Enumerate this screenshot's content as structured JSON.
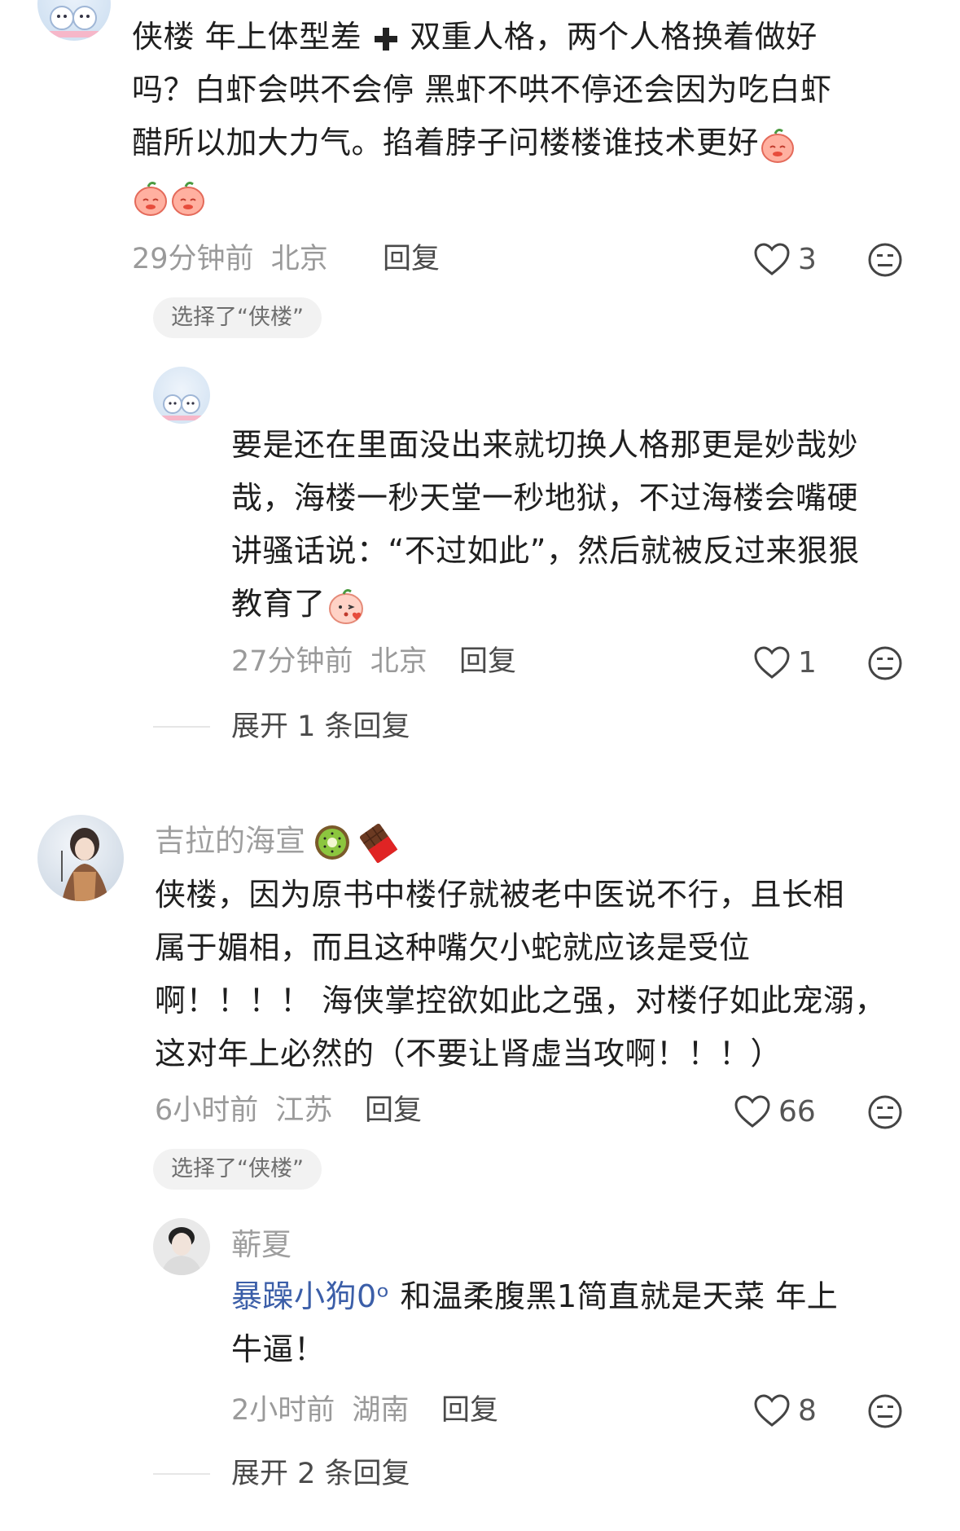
{
  "comments": [
    {
      "text_lines": [
        "侠楼 年上体型差 ",
        " 双重人格，两个人格换着做好",
        "吗？白虾会哄不会停  黑虾不哄不停还会因为吃白虾",
        "醋所以加大力气。掐着脖子问楼楼谁技术更好"
      ],
      "time": "29分钟前",
      "location": "北京",
      "reply_label": "回复",
      "likes": "3",
      "tag": "选择了“侠楼”",
      "replies": [
        {
          "text_lines": [
            "要是还在里面没出来就切换人格那更是妙哉妙",
            "哉，海楼一秒天堂一秒地狱，不过海楼会嘴硬",
            "讲骚话说：“不过如此”，然后就被反过来狠狠",
            "教育了"
          ],
          "time": "27分钟前",
          "location": "北京",
          "reply_label": "回复",
          "likes": "1"
        }
      ],
      "expand_label": "展开 1 条回复"
    },
    {
      "username": "吉拉的海宣",
      "text_lines": [
        "侠楼，因为原书中楼仔就被老中医说不行，且长相",
        "属于媚相，而且这种嘴欠小蛇就应该是受位",
        "啊！！！！ 海侠掌控欲如此之强，对楼仔如此宠溺，",
        "这对年上必然的（不要让肾虚当攻啊！！！）"
      ],
      "time": "6小时前",
      "location": "江苏",
      "reply_label": "回复",
      "likes": "66",
      "tag": "选择了“侠楼”",
      "replies": [
        {
          "username": "蕲夏",
          "mention": "暴躁小狗0ᵒ",
          "text_lines": [
            " 和温柔腹黑1简直就是天菜 年上",
            "牛逼！"
          ],
          "time": "2小时前",
          "location": "湖南",
          "reply_label": "回复",
          "likes": "8"
        }
      ],
      "expand_label": "展开 2 条回复"
    }
  ],
  "icons": {
    "like": "heart-outline-icon",
    "dislike": "neutral-face-icon",
    "plus": "heavy-plus-icon"
  },
  "colors": {
    "meta": "#9a9a9a",
    "mention": "#3b5ea8",
    "tag_bg": "#f2f2f2"
  }
}
